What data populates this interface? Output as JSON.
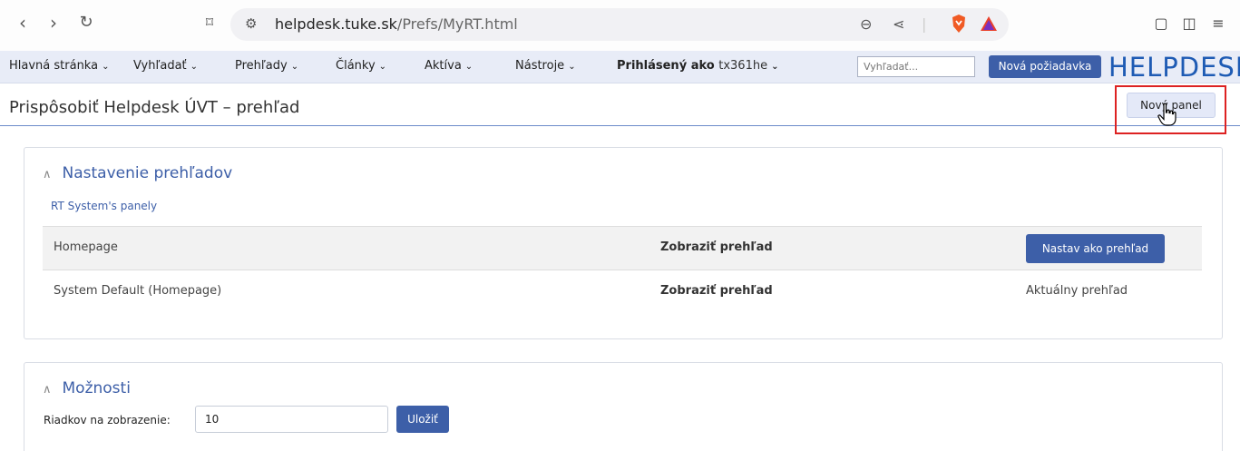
{
  "browser": {
    "url_domain": "helpdesk.tuke.sk",
    "url_path": "/Prefs/MyRT.html"
  },
  "nav": {
    "items": [
      {
        "label": "Hlavná stránka"
      },
      {
        "label": "Vyhľadať"
      },
      {
        "label": "Prehľady"
      },
      {
        "label": "Články"
      },
      {
        "label": "Aktíva"
      },
      {
        "label": "Nástroje"
      }
    ],
    "logged_label": "Prihlásený ako",
    "username": "tx361he",
    "search_placeholder": "Vyhľadať...",
    "new_request_label": "Nová požiadavka",
    "logo": "HELPDESK"
  },
  "page": {
    "title": "Prispôsobiť Helpdesk ÚVT – prehľad",
    "new_panel_label": "Nový panel"
  },
  "dashboards": {
    "title": "Nastavenie prehľadov",
    "section_link": "RT System's panely",
    "rows": [
      {
        "name": "Homepage",
        "view": "Zobraziť prehľad",
        "action_button": "Nastav ako prehľad"
      },
      {
        "name": "System Default (Homepage)",
        "view": "Zobraziť prehľad",
        "status": "Aktuálny prehľad"
      }
    ]
  },
  "options": {
    "title": "Možnosti",
    "rows_label": "Riadkov na zobrazenie:",
    "rows_value": "10",
    "save_label": "Uložiť"
  },
  "colors": {
    "accent": "#3d5fa8",
    "highlight": "#dd2222",
    "logo": "#1e5bb4"
  }
}
